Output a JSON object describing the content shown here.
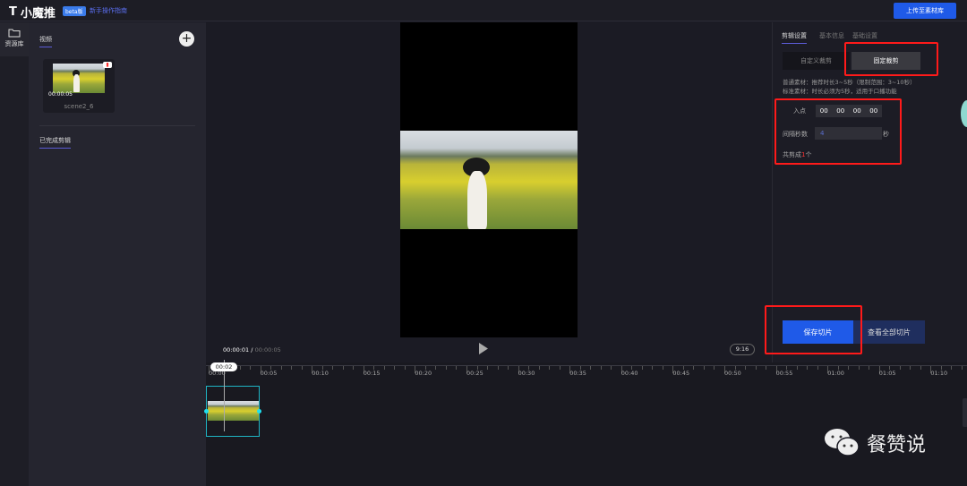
{
  "header": {
    "logo": "小魔推",
    "beta": "beta版",
    "guide_link": "新手操作指南",
    "upload_button": "上传至素材库"
  },
  "rail": {
    "items": [
      {
        "label": "资源库",
        "icon": "folder-icon"
      }
    ]
  },
  "assets": {
    "tab": "视频",
    "add_icon": "plus-icon",
    "cards": [
      {
        "duration": "00:00:05",
        "name": "scene2_6",
        "delete_icon": "trash-icon"
      }
    ],
    "section": "已完成剪辑"
  },
  "player": {
    "current_time": "00:00:01",
    "total_time": "00:00:05",
    "separator": "/",
    "aspect": "9:16",
    "play_icon": "play-icon"
  },
  "settings": {
    "tabs": [
      "剪辑设置",
      "基本信息",
      "基础设置"
    ],
    "modes": [
      "自定义裁剪",
      "固定裁剪"
    ],
    "active_mode": "固定裁剪",
    "hint1": "普通素材：推荐时长3~5秒（限制范围：3~10秒）",
    "hint2": "标准素材：时长必须为5秒，适用于口播功能",
    "in_point_label": "入点",
    "in_point": [
      "00",
      "00",
      "00",
      "00"
    ],
    "interval_label": "间隔秒数",
    "interval_value": "4",
    "interval_unit": "秒",
    "count_prefix": "共剪成",
    "count": "1",
    "count_suffix": "个",
    "save_button": "保存切片",
    "view_all_button": "查看全部切片"
  },
  "timeline": {
    "playhead": "00:02",
    "ticks": [
      "00:00",
      "00:05",
      "00:10",
      "00:15",
      "00:20",
      "00:25",
      "00:30",
      "00:35",
      "00:40",
      "00:45",
      "00:50",
      "00:55",
      "01:00",
      "01:05",
      "01:10"
    ]
  },
  "watermark": {
    "text": "餐赞说",
    "icon": "wechat-icon"
  },
  "colors": {
    "accent": "#1f5ae8",
    "annotation": "#ff1a1a",
    "clip_border": "#1fb5c4"
  }
}
